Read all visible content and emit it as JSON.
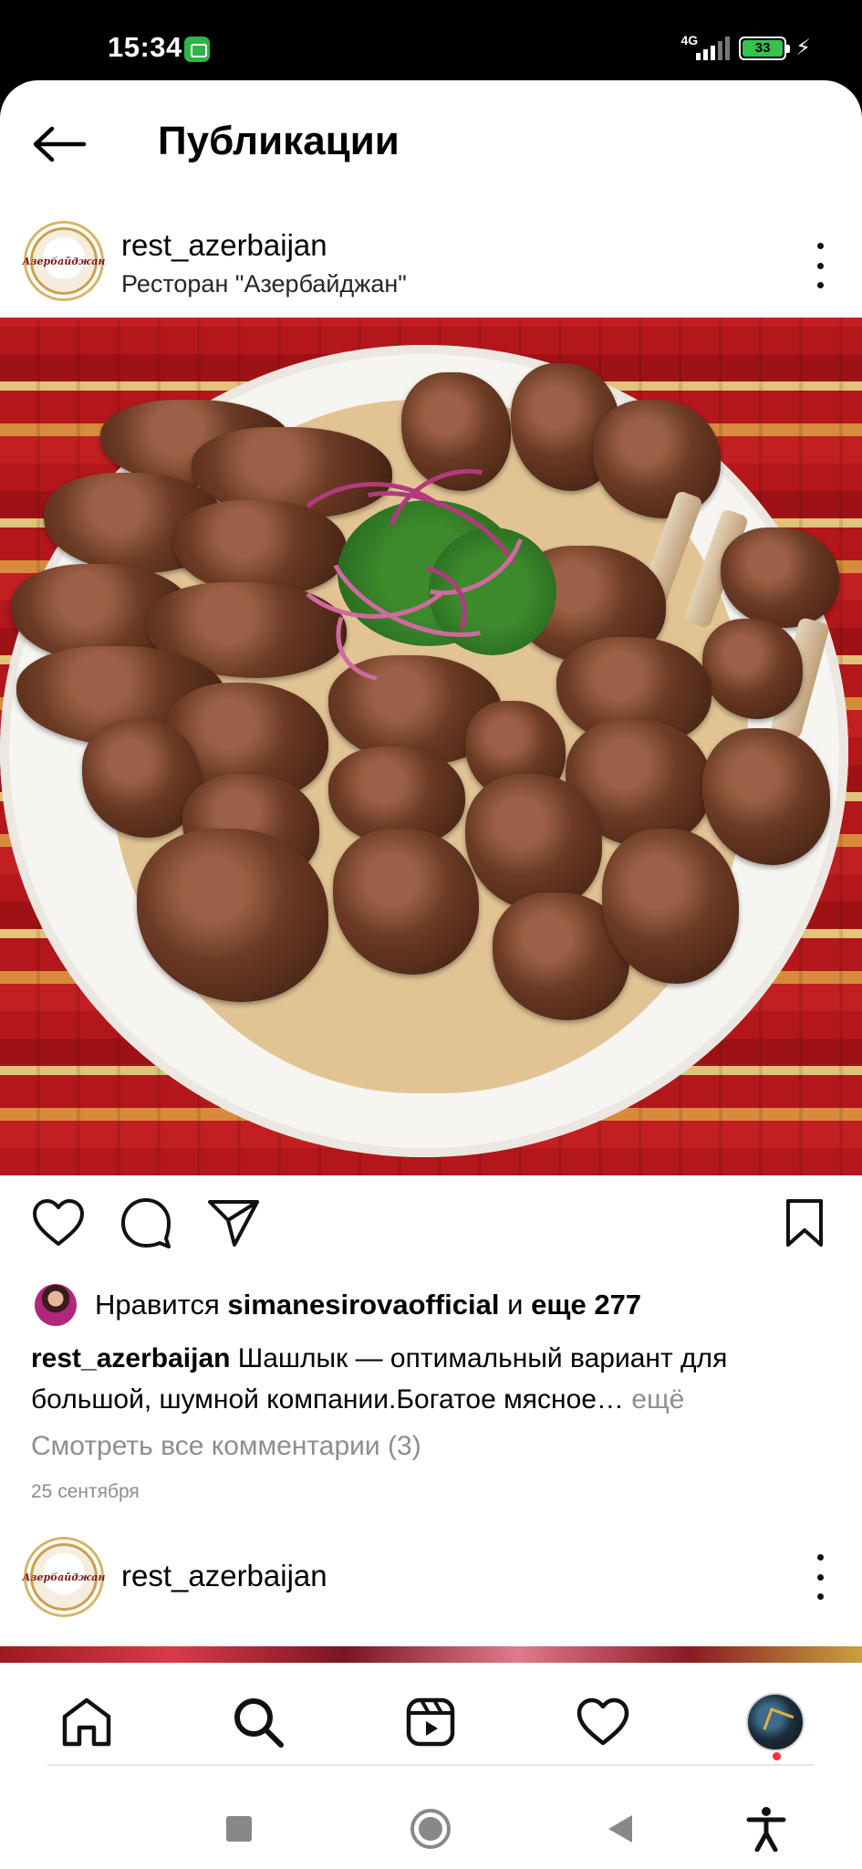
{
  "status_bar": {
    "time": "15:34",
    "network": "4G",
    "battery": "33"
  },
  "header": {
    "title": "Публикации"
  },
  "post": {
    "username": "rest_azerbaijan",
    "location": "Ресторан \"Азербайджан\"",
    "avatar_text": "Азербайджан",
    "likes": {
      "prefix": "Нравится",
      "user": "simanesirovaofficial",
      "conjunction": "и",
      "others": "еще 277"
    },
    "caption": {
      "username": "rest_azerbaijan",
      "text": "Шашлык — оптимальный вариант для большой, шумной компании.Богатое мясное…",
      "more": "ещё"
    },
    "comments_link": "Смотреть все комментарии (3)",
    "date": "25 сентября"
  },
  "next_post": {
    "username": "rest_azerbaijan",
    "avatar_text": "Азербайджан"
  },
  "colors": {
    "accent_notification": "#ff3040",
    "secondary_text": "#8e8e8e",
    "battery_green": "#37c14f"
  },
  "icons": {
    "back": "arrow-left-icon",
    "like": "heart-icon",
    "comment": "comment-bubble-icon",
    "share": "paper-plane-icon",
    "save": "bookmark-icon",
    "home": "home-icon",
    "search": "search-icon",
    "reels": "reels-icon",
    "activity": "heart-icon",
    "profile": "profile-avatar"
  }
}
